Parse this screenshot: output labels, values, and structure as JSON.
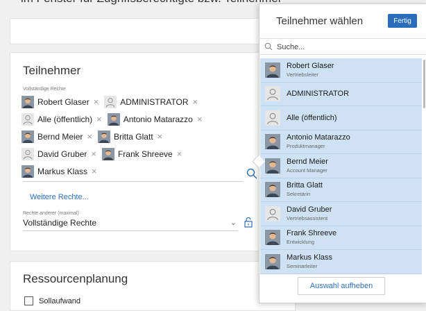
{
  "background_text": "im Fenster für Zugriffsberechtigte bzw. Teilnehmer",
  "participants": {
    "title": "Teilnehmer",
    "rights_label": "Vollständige Rechte",
    "chips": [
      {
        "name": "Robert Glaser",
        "avatar": "photo"
      },
      {
        "name": "ADMINISTRATOR",
        "avatar": "generic"
      },
      {
        "name": "Alle (öffentlich)",
        "avatar": "generic"
      },
      {
        "name": "Antonio Matarazzo",
        "avatar": "photo"
      },
      {
        "name": "Bernd Meier",
        "avatar": "photo"
      },
      {
        "name": "Britta Glatt",
        "avatar": "photo"
      },
      {
        "name": "David Gruber",
        "avatar": "generic"
      },
      {
        "name": "Frank Shreeve",
        "avatar": "photo"
      },
      {
        "name": "Markus Klass",
        "avatar": "photo"
      }
    ],
    "remove_symbol": "×",
    "more_rights": "Weitere Rechte...",
    "others_label": "Rechte anderer (maximal)",
    "others_value": "Vollständige Rechte",
    "chevron": "⌄"
  },
  "resources": {
    "title": "Ressourcenplanung",
    "checkbox_label": "Sollaufwand"
  },
  "picker": {
    "title": "Teilnehmer wählen",
    "done": "Fertig",
    "search_placeholder": "Suche...",
    "items": [
      {
        "name": "Robert Glaser",
        "role": "Vertriebsleiter",
        "avatar": "photo"
      },
      {
        "name": "ADMINISTRATOR",
        "role": "",
        "avatar": "generic"
      },
      {
        "name": "Alle (öffentlich)",
        "role": "",
        "avatar": "generic"
      },
      {
        "name": "Antonio Matarazzo",
        "role": "Produktmanager",
        "avatar": "photo"
      },
      {
        "name": "Bernd Meier",
        "role": "Account Manager",
        "avatar": "photo"
      },
      {
        "name": "Britta Glatt",
        "role": "Sekretärin",
        "avatar": "photo"
      },
      {
        "name": "David Gruber",
        "role": "Vertriebsassistent",
        "avatar": "generic"
      },
      {
        "name": "Frank Shreeve",
        "role": "Entwicklung",
        "avatar": "photo"
      },
      {
        "name": "Markus Klass",
        "role": "Seminarleiter",
        "avatar": "photo"
      }
    ],
    "clear": "Auswahl aufheben"
  },
  "colors": {
    "accent": "#2a6ebb",
    "selected_row": "#cfe2f5"
  }
}
